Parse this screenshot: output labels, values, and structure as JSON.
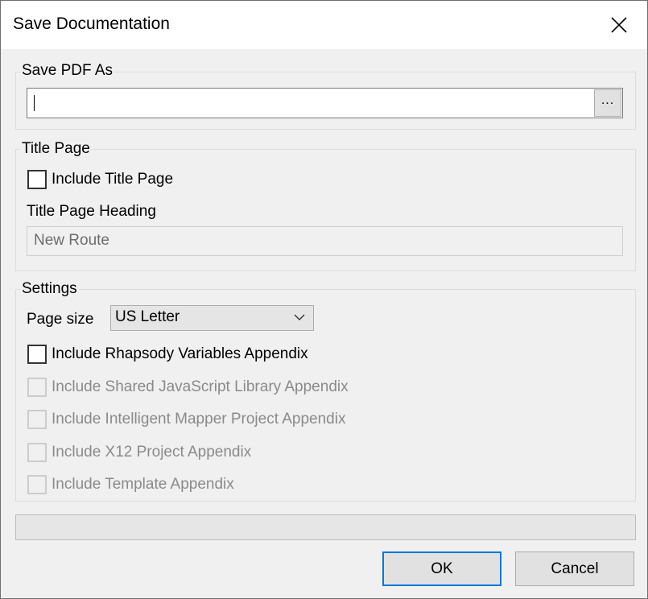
{
  "window": {
    "title": "Save Documentation",
    "close_icon": "close-icon"
  },
  "save_pdf": {
    "group_label": "Save PDF As",
    "path_value": "",
    "browse_label": "..."
  },
  "title_page": {
    "group_label": "Title Page",
    "include_label": "Include Title Page",
    "include_checked": false,
    "heading_label": "Title Page Heading",
    "heading_value": "New Route"
  },
  "settings": {
    "group_label": "Settings",
    "page_size_label": "Page size",
    "page_size_value": "US Letter",
    "options": [
      {
        "label": "Include Rhapsody Variables Appendix",
        "checked": false,
        "enabled": true
      },
      {
        "label": "Include Shared JavaScript Library Appendix",
        "checked": false,
        "enabled": false
      },
      {
        "label": "Include Intelligent Mapper Project Appendix",
        "checked": false,
        "enabled": false
      },
      {
        "label": "Include X12 Project Appendix",
        "checked": false,
        "enabled": false
      },
      {
        "label": "Include Template Appendix",
        "checked": false,
        "enabled": false
      }
    ]
  },
  "progress": {
    "value": 0
  },
  "buttons": {
    "ok_label": "OK",
    "cancel_label": "Cancel"
  },
  "colors": {
    "accent": "#0078d7",
    "disabled_text": "#8a8a8a"
  }
}
